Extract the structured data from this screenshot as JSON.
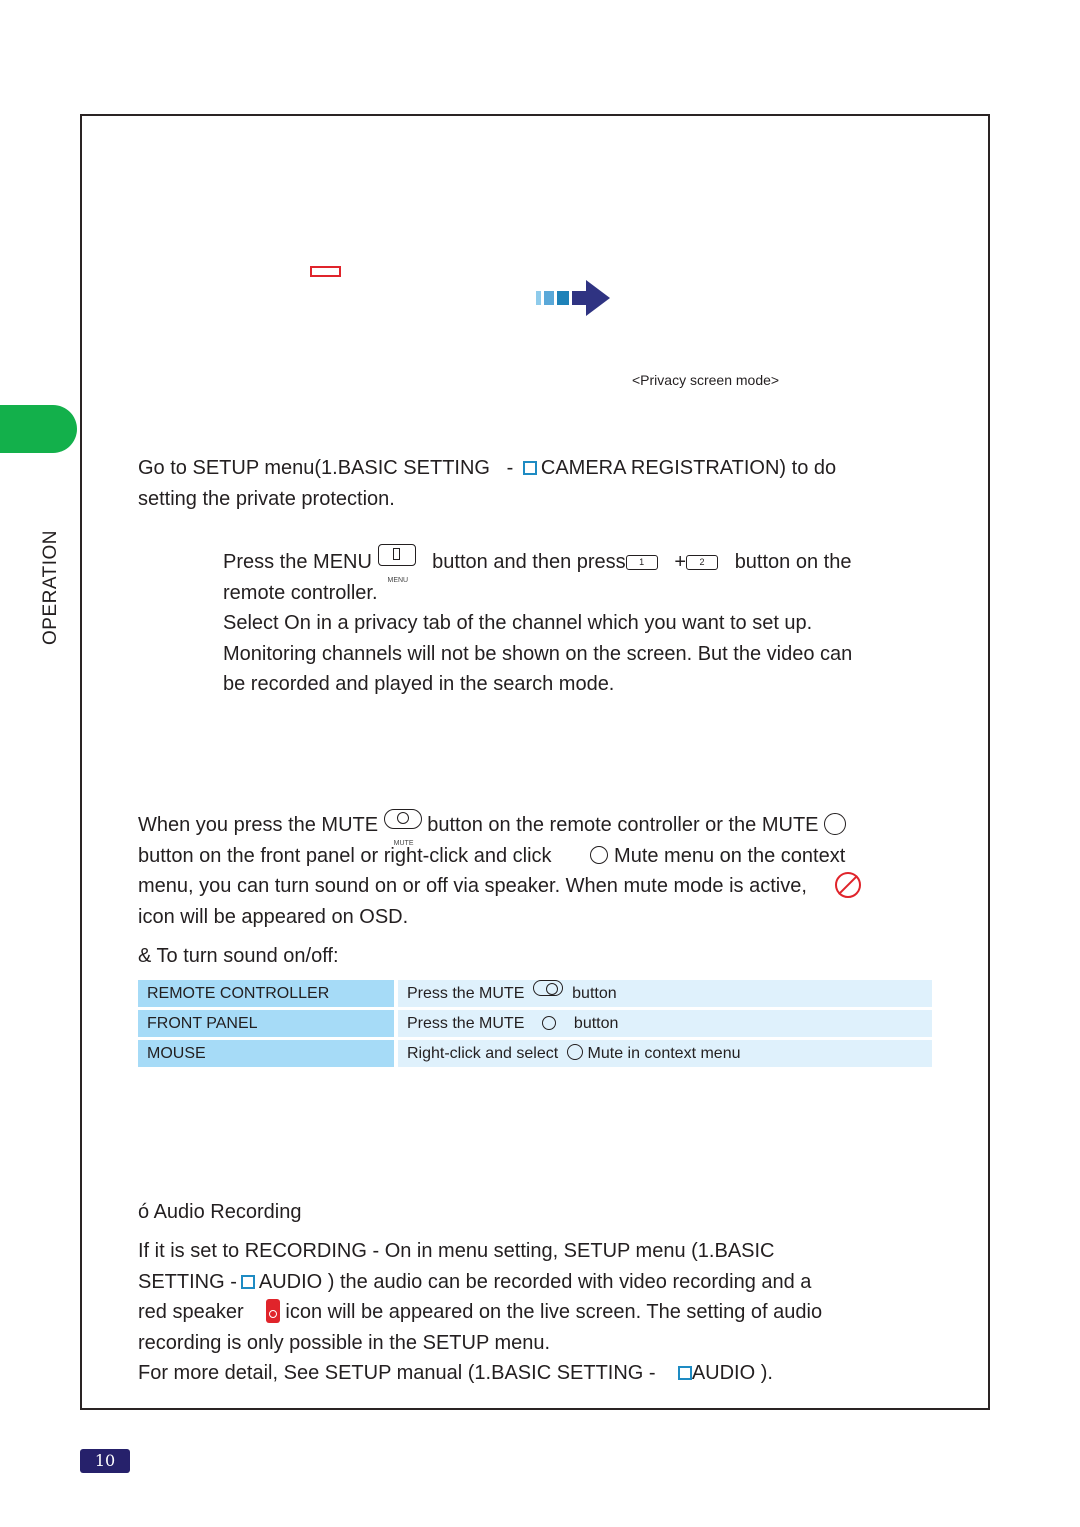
{
  "side_tab": {
    "label": "OPERATION",
    "color": "#13b04b"
  },
  "figure": {
    "caption": "<Privacy screen mode>"
  },
  "privacy": {
    "intro_l1_a": "Go to SETUP menu(1.BASIC SETTING",
    "intro_l1_b": "-",
    "intro_l1_c": "CAMERA REGISTRATION) to do",
    "intro_l2": "setting the private protection.",
    "step1_a": "Press the MENU",
    "step1_menu_caption": "MENU",
    "step1_b": "button and then press",
    "key1": "1",
    "plus": "+",
    "key2": "2",
    "step1_c": "button on the",
    "step1_l2": "remote controller.",
    "step2_l1": "Select  On  in a privacy tab of the channel which you want to set up.",
    "step2_l2": "Monitoring channels will not be shown on the screen. But the video can",
    "step2_l3": "be recorded and played in the search mode."
  },
  "mute": {
    "l1_a": "When you press the  MUTE",
    "l1_b": "button on the remote controller or the    MUTE",
    "mute_caption": "MUTE",
    "l2_a": "button on the front panel or right-click and click",
    "l2_b": "Mute menu on the context",
    "l3": "menu, you can turn sound on or off via speaker. When mute mode is active,",
    "l4": "icon will be appeared on OSD.",
    "subheading": "&   To turn sound on/off:"
  },
  "table": {
    "rows": [
      {
        "source": "REMOTE CONTROLLER",
        "action_a": "Press the MUTE",
        "action_b": "button"
      },
      {
        "source": "FRONT PANEL",
        "action_a": "Press the MUTE",
        "action_b": "button"
      },
      {
        "source": "MOUSE",
        "action_a": "Right-click and select",
        "action_b": "Mute in context menu"
      }
    ]
  },
  "audio": {
    "heading": "ó  Audio Recording",
    "l1": "If it is set to  RECORDING - On  in menu setting, SETUP      menu  (1.BASIC",
    "l2_a": "SETTING  -",
    "l2_b": "AUDIO ) the audio can be recorded with video recording and a",
    "l3_a": "red speaker",
    "l3_b": "icon will be appeared on the live screen. The setting of audio",
    "l4": "recording is only possible in the    SETUP menu.",
    "l5_a": "For more detail, See  SETUP manual (1.BASIC SETTING -",
    "l5_b": "AUDIO   )."
  },
  "page_number": "10"
}
